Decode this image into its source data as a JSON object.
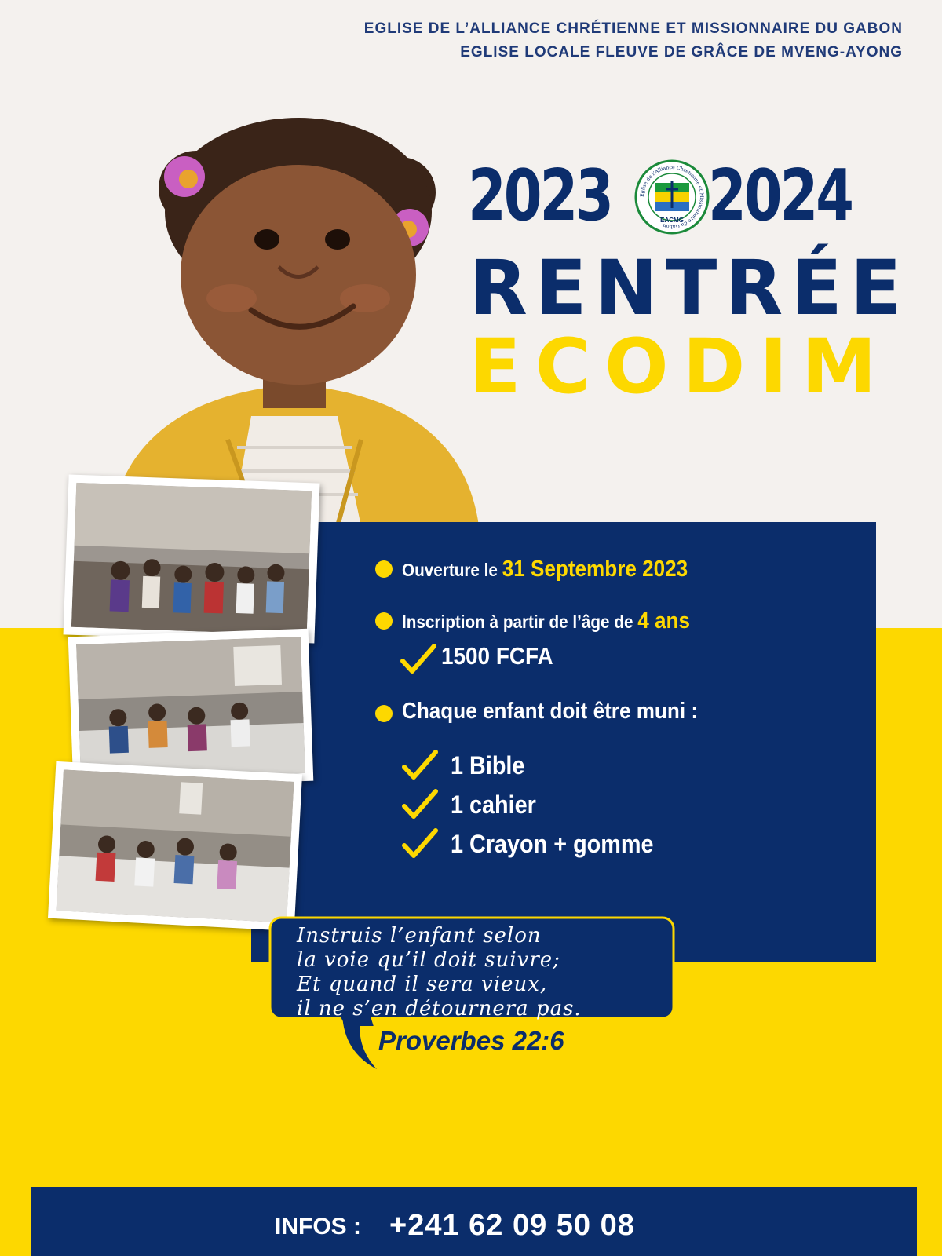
{
  "header": {
    "line1": "EGLISE DE L’ALLIANCE CHRÉTIENNE ET MISSIONNAIRE DU GABON",
    "line2": "EGLISE LOCALE FLEUVE DE GRÂCE DE MVENG-AYONG"
  },
  "years": {
    "start": "2023",
    "end": "2024"
  },
  "seal": {
    "ring_text": "Eglise de l’Alliance Chrétienne et Missionnaire du Gabon",
    "abbrev": "EACMG"
  },
  "title": {
    "line1": "RENTRÉE",
    "line2": "ECODIM"
  },
  "info": {
    "opening_prefix": "Ouverture le ",
    "opening_date": "31 Septembre 2023",
    "registration_prefix": "Inscription à partir de l’âge de ",
    "registration_age": "4 ans",
    "fee": "1500 FCFA",
    "supplies_heading": "Chaque enfant doit être muni :",
    "supplies": [
      "1 Bible",
      "1 cahier",
      "1 Crayon + gomme"
    ]
  },
  "verse": {
    "lines": [
      "Instruis l’enfant selon",
      "la voie qu’il doit suivre;",
      "Et quand il sera vieux,",
      "il ne s’en détournera pas."
    ],
    "reference": "Proverbes 22:6"
  },
  "footer": {
    "label": "INFOS :",
    "phone": "+241 62 09 50 08"
  },
  "colors": {
    "navy": "#0b2d6b",
    "yellow": "#fdd800",
    "cream": "#f4f1ee"
  }
}
